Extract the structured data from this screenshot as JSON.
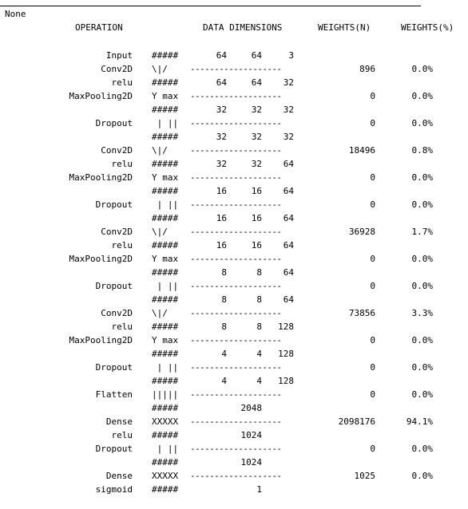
{
  "none_label": "None",
  "headers": {
    "operation": "OPERATION",
    "dims": "DATA DIMENSIONS",
    "weights_n": "WEIGHTS(N)",
    "weights_pct": "WEIGHTS(%)"
  },
  "rows": [
    {
      "op": "Input",
      "sym": "#####",
      "dash": "",
      "d1": "64",
      "d2": "64",
      "d3": "3",
      "w": "",
      "p": ""
    },
    {
      "op": "Conv2D",
      "sym": "\\|/",
      "dash": "-------------------",
      "d1": "",
      "d2": "",
      "d3": "",
      "w": "896",
      "p": "0.0%"
    },
    {
      "op": "relu",
      "sym": "#####",
      "dash": "",
      "d1": "64",
      "d2": "64",
      "d3": "32",
      "w": "",
      "p": ""
    },
    {
      "op": "MaxPooling2D",
      "sym": "Y max",
      "dash": "-------------------",
      "d1": "",
      "d2": "",
      "d3": "",
      "w": "0",
      "p": "0.0%"
    },
    {
      "op": "",
      "sym": "#####",
      "dash": "",
      "d1": "32",
      "d2": "32",
      "d3": "32",
      "w": "",
      "p": ""
    },
    {
      "op": "Dropout",
      "sym": " | ||",
      "dash": "-------------------",
      "d1": "",
      "d2": "",
      "d3": "",
      "w": "0",
      "p": "0.0%"
    },
    {
      "op": "",
      "sym": "#####",
      "dash": "",
      "d1": "32",
      "d2": "32",
      "d3": "32",
      "w": "",
      "p": ""
    },
    {
      "op": "Conv2D",
      "sym": "\\|/",
      "dash": "-------------------",
      "d1": "",
      "d2": "",
      "d3": "",
      "w": "18496",
      "p": "0.8%"
    },
    {
      "op": "relu",
      "sym": "#####",
      "dash": "",
      "d1": "32",
      "d2": "32",
      "d3": "64",
      "w": "",
      "p": ""
    },
    {
      "op": "MaxPooling2D",
      "sym": "Y max",
      "dash": "-------------------",
      "d1": "",
      "d2": "",
      "d3": "",
      "w": "0",
      "p": "0.0%"
    },
    {
      "op": "",
      "sym": "#####",
      "dash": "",
      "d1": "16",
      "d2": "16",
      "d3": "64",
      "w": "",
      "p": ""
    },
    {
      "op": "Dropout",
      "sym": " | ||",
      "dash": "-------------------",
      "d1": "",
      "d2": "",
      "d3": "",
      "w": "0",
      "p": "0.0%"
    },
    {
      "op": "",
      "sym": "#####",
      "dash": "",
      "d1": "16",
      "d2": "16",
      "d3": "64",
      "w": "",
      "p": ""
    },
    {
      "op": "Conv2D",
      "sym": "\\|/",
      "dash": "-------------------",
      "d1": "",
      "d2": "",
      "d3": "",
      "w": "36928",
      "p": "1.7%"
    },
    {
      "op": "relu",
      "sym": "#####",
      "dash": "",
      "d1": "16",
      "d2": "16",
      "d3": "64",
      "w": "",
      "p": ""
    },
    {
      "op": "MaxPooling2D",
      "sym": "Y max",
      "dash": "-------------------",
      "d1": "",
      "d2": "",
      "d3": "",
      "w": "0",
      "p": "0.0%"
    },
    {
      "op": "",
      "sym": "#####",
      "dash": "",
      "d1": "8",
      "d2": "8",
      "d3": "64",
      "w": "",
      "p": ""
    },
    {
      "op": "Dropout",
      "sym": " | ||",
      "dash": "-------------------",
      "d1": "",
      "d2": "",
      "d3": "",
      "w": "0",
      "p": "0.0%"
    },
    {
      "op": "",
      "sym": "#####",
      "dash": "",
      "d1": "8",
      "d2": "8",
      "d3": "64",
      "w": "",
      "p": ""
    },
    {
      "op": "Conv2D",
      "sym": "\\|/",
      "dash": "-------------------",
      "d1": "",
      "d2": "",
      "d3": "",
      "w": "73856",
      "p": "3.3%"
    },
    {
      "op": "relu",
      "sym": "#####",
      "dash": "",
      "d1": "8",
      "d2": "8",
      "d3": "128",
      "w": "",
      "p": ""
    },
    {
      "op": "MaxPooling2D",
      "sym": "Y max",
      "dash": "-------------------",
      "d1": "",
      "d2": "",
      "d3": "",
      "w": "0",
      "p": "0.0%"
    },
    {
      "op": "",
      "sym": "#####",
      "dash": "",
      "d1": "4",
      "d2": "4",
      "d3": "128",
      "w": "",
      "p": ""
    },
    {
      "op": "Dropout",
      "sym": " | ||",
      "dash": "-------------------",
      "d1": "",
      "d2": "",
      "d3": "",
      "w": "0",
      "p": "0.0%"
    },
    {
      "op": "",
      "sym": "#####",
      "dash": "",
      "d1": "4",
      "d2": "4",
      "d3": "128",
      "w": "",
      "p": ""
    },
    {
      "op": "Flatten",
      "sym": "|||||",
      "dash": "-------------------",
      "d1": "",
      "d2": "",
      "d3": "",
      "w": "0",
      "p": "0.0%"
    },
    {
      "op": "",
      "sym": "#####",
      "dash": "",
      "d1": "",
      "d2": "2048",
      "d3": "",
      "w": "",
      "p": ""
    },
    {
      "op": "Dense",
      "sym": "XXXXX",
      "dash": "-------------------",
      "d1": "",
      "d2": "",
      "d3": "",
      "w": "2098176",
      "p": "94.1%"
    },
    {
      "op": "relu",
      "sym": "#####",
      "dash": "",
      "d1": "",
      "d2": "1024",
      "d3": "",
      "w": "",
      "p": ""
    },
    {
      "op": "Dropout",
      "sym": " | ||",
      "dash": "-------------------",
      "d1": "",
      "d2": "",
      "d3": "",
      "w": "0",
      "p": "0.0%"
    },
    {
      "op": "",
      "sym": "#####",
      "dash": "",
      "d1": "",
      "d2": "1024",
      "d3": "",
      "w": "",
      "p": ""
    },
    {
      "op": "Dense",
      "sym": "XXXXX",
      "dash": "-------------------",
      "d1": "",
      "d2": "",
      "d3": "",
      "w": "1025",
      "p": "0.0%"
    },
    {
      "op": "sigmoid",
      "sym": "#####",
      "dash": "",
      "d1": "",
      "d2": "1",
      "d3": "",
      "w": "",
      "p": ""
    }
  ]
}
